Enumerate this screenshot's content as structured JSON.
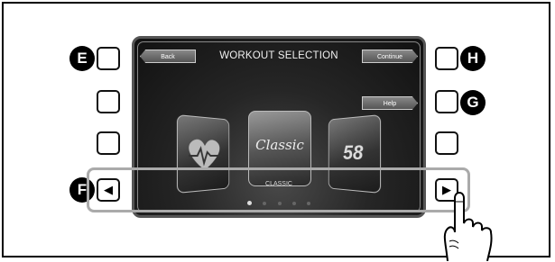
{
  "screen": {
    "title": "WORKOUT SELECTION",
    "back_label": "Back",
    "continue_label": "Continue",
    "help_label": "Help",
    "center_card_text": "Classic",
    "right_card_text": "58",
    "selected_label": "CLASSIC",
    "page_dots": 5,
    "active_dot": 1
  },
  "markers": {
    "e": "E",
    "f": "F",
    "g": "G",
    "h": "H"
  },
  "arrows": {
    "left": "◀",
    "right": "▶"
  },
  "icons": {
    "left_card": "heart-pulse-icon",
    "hand": "pointing-hand-icon"
  }
}
